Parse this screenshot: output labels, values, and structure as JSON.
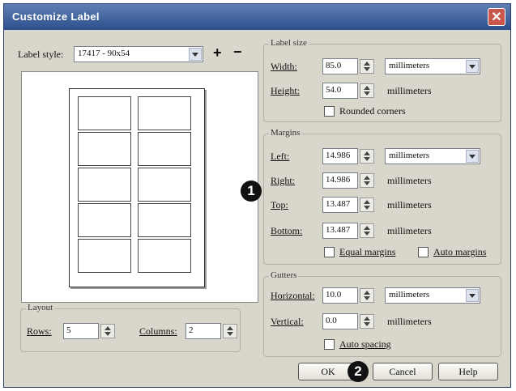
{
  "window": {
    "title": "Customize Label",
    "close_glyph": "✕"
  },
  "label_style": {
    "label": "Label style:",
    "value": "17417 - 90x54",
    "add_glyph": "+",
    "remove_glyph": "−"
  },
  "label_size": {
    "title": "Label size",
    "width_label": "Width:",
    "width_value": "85.0",
    "width_unit": "millimeters",
    "height_label": "Height:",
    "height_value": "54.0",
    "height_unit": "millimeters",
    "rounded_label": "Rounded corners"
  },
  "margins": {
    "title": "Margins",
    "left_label": "Left:",
    "left_value": "14.986",
    "left_unit": "millimeters",
    "right_label": "Right:",
    "right_value": "14.986",
    "right_unit": "millimeters",
    "top_label": "Top:",
    "top_value": "13.487",
    "top_unit": "millimeters",
    "bottom_label": "Bottom:",
    "bottom_value": "13.487",
    "bottom_unit": "millimeters",
    "equal_label": "Equal margins",
    "auto_label": "Auto margins"
  },
  "gutters": {
    "title": "Gutters",
    "horizontal_label": "Horizontal:",
    "horizontal_value": "10.0",
    "horizontal_unit": "millimeters",
    "vertical_label": "Vertical:",
    "vertical_value": "0.0",
    "vertical_unit": "millimeters",
    "auto_spacing_label": "Auto spacing"
  },
  "layout": {
    "title": "Layout",
    "rows_label": "Rows:",
    "rows_value": "5",
    "columns_label": "Columns:",
    "columns_value": "2"
  },
  "preview": {
    "rows": 5,
    "columns": 2
  },
  "buttons": {
    "ok": "OK",
    "cancel": "Cancel",
    "help": "Help"
  },
  "callouts": {
    "one": "1",
    "two": "2"
  }
}
